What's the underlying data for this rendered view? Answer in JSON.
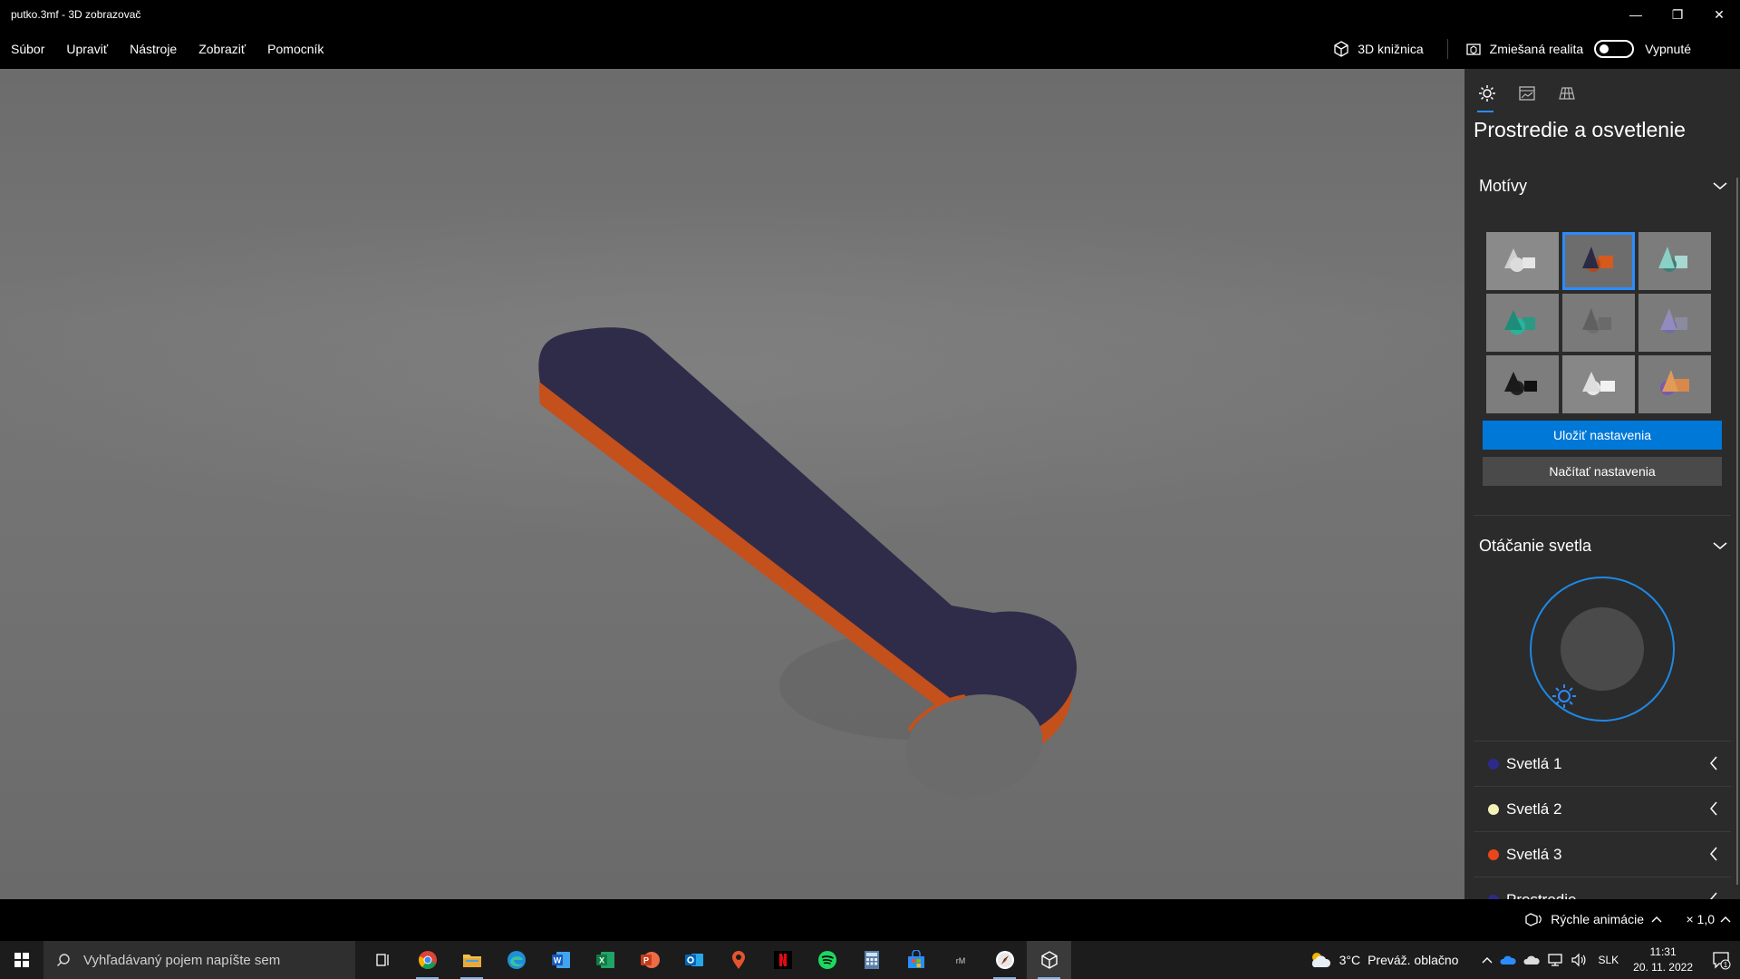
{
  "window": {
    "title": "putko.3mf - 3D zobrazovač",
    "minimize_glyph": "—",
    "restore_glyph": "❐",
    "close_glyph": "✕"
  },
  "menu": {
    "items": [
      "Súbor",
      "Upraviť",
      "Nástroje",
      "Zobraziť",
      "Pomocník"
    ],
    "library_label": "3D knižnica",
    "mixed_reality_label": "Zmiešaná realita",
    "mixed_reality_state": "Vypnuté"
  },
  "panel": {
    "tabs": [
      "sun-icon",
      "stats-icon",
      "grid-icon"
    ],
    "title": "Prostredie a osvetlenie",
    "themes_header": "Motívy",
    "themes_selected_index": 1,
    "save_button": "Uložiť nastavenia",
    "load_button": "Načítať nastavenia",
    "rotation_header": "Otáčanie svetla",
    "lights": [
      {
        "label": "Svetlá 1",
        "color": "#2e2a8a"
      },
      {
        "label": "Svetlá 2",
        "color": "#f4f1b8"
      },
      {
        "label": "Svetlá 3",
        "color": "#e8471c"
      },
      {
        "label": "Prostredie",
        "color": "#2e2a8a"
      }
    ]
  },
  "status": {
    "animation_label": "Rýchle animácie",
    "speed_label": "× 1,0"
  },
  "taskbar": {
    "search_placeholder": "Vyhľadávaný pojem napíšte sem",
    "weather_temp": "3°C",
    "weather_text": "Preváž. oblačno",
    "language": "SLK",
    "time": "11:31",
    "date": "20. 11. 2022",
    "notification_count": "1"
  },
  "colors": {
    "accent": "#0078d7",
    "model": "#2f2c4a",
    "model_edge": "#c4501c"
  }
}
